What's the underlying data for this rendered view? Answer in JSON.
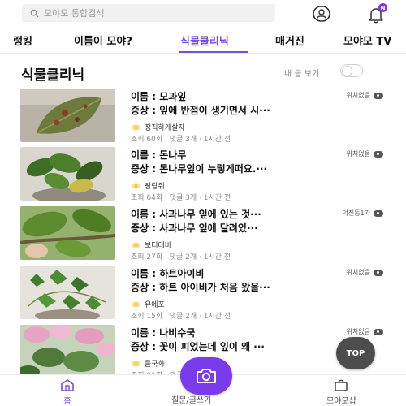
{
  "search": {
    "placeholder": "모야모 통합검색"
  },
  "notifications": {
    "badge": "N"
  },
  "tabs": [
    {
      "label": "랭킹"
    },
    {
      "label": "이름이 모야?"
    },
    {
      "label": "식물클리닉"
    },
    {
      "label": "매거진"
    },
    {
      "label": "모야모 TV"
    }
  ],
  "page": {
    "title": "식물클리닉",
    "mine_label": "내 글 보기"
  },
  "items": [
    {
      "title": "이름 : 모과잎",
      "symptom": "증상 : 잎에 반점이 생기면서 시···",
      "location": "위치없음",
      "author": "정직하게살자",
      "meta": "조회 60회 · 댓글 3개 · 1시간 전"
    },
    {
      "title": "이름 : 돈나무",
      "symptom": "증상 : 돈나무잎이 누렇게떠요.···",
      "location": "위치없음",
      "author": "빵랑쥐",
      "meta": "조회 64회 · 댓글 3개 · 1시간 전"
    },
    {
      "title": "이름 : 사과나무 잎에 있는 것···",
      "symptom": "증상 : 사과나무 잎에 달려있···",
      "location": "덕진동1가",
      "author": "보디데바",
      "meta": "조회 27회 · 댓글 2개 · 1시간 전"
    },
    {
      "title": "이름 : 하트아이비",
      "symptom": "증상 : 하트 아이비가 처음 왔을···",
      "location": "위치없음",
      "author": "유에포",
      "meta": "조회 15회 · 댓글 2개 · 1시간 전"
    },
    {
      "title": "이름 : 나비수국",
      "symptom": "증상 : 꽃이 피었는데 잎이 왜 ···",
      "location": "위치없음",
      "author": "들국화",
      "meta": "조회 21회 · 댓글 2개 · 1시간 전"
    }
  ],
  "floating": {
    "top_label": "TOP"
  },
  "bottom_nav": {
    "home": "홈",
    "ask": "질문/글쓰기",
    "shop": "모야모샵"
  },
  "colors": {
    "accent": "#7c3aed",
    "tab_active": "#7c4ddb"
  }
}
